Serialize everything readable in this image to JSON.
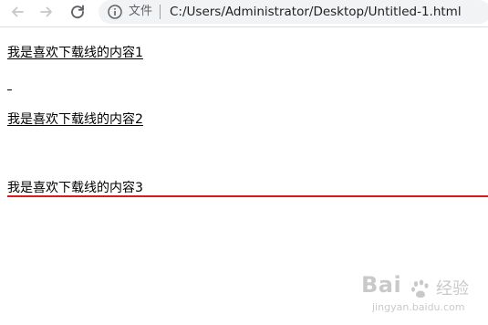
{
  "browser": {
    "back_icon": "back-arrow-icon",
    "forward_icon": "forward-arrow-icon",
    "reload_icon": "reload-icon",
    "info_icon": "info-icon",
    "scheme_label": "文件",
    "url": "C:/Users/Administrator/Desktop/Untitled-1.html"
  },
  "page": {
    "line1": "我是喜欢下载线的内容1",
    "line2": "我是喜欢下载线的内容2",
    "line3": "我是喜欢下载线的内容3",
    "accent_color": "#e01818"
  },
  "watermark": {
    "brand": "Bai",
    "suffix": "经验",
    "domain": "jingyan.baidu.com"
  }
}
